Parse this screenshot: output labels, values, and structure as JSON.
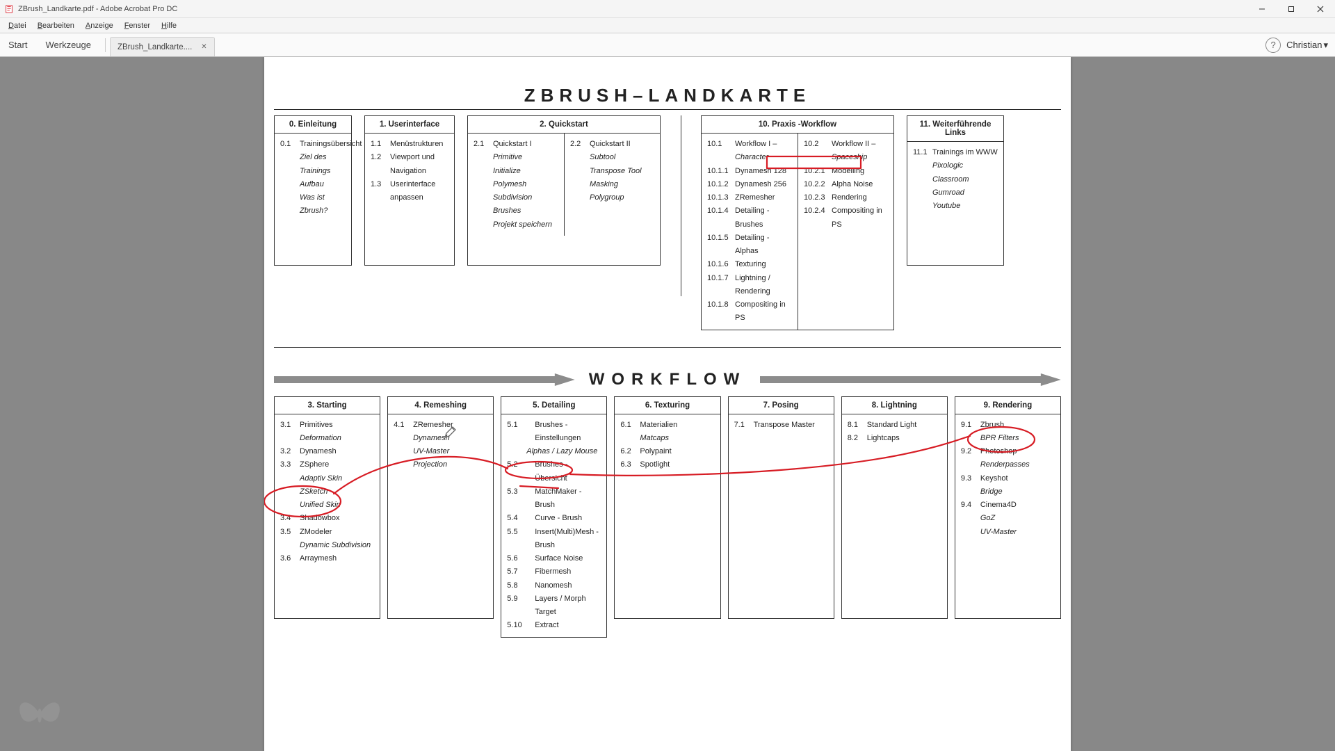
{
  "window": {
    "title": "ZBrush_Landkarte.pdf - Adobe Acrobat Pro DC"
  },
  "menu": {
    "items": [
      {
        "hot": "D",
        "rest": "atei"
      },
      {
        "hot": "B",
        "rest": "earbeiten"
      },
      {
        "hot": "A",
        "rest": "nzeige"
      },
      {
        "hot": "F",
        "rest": "enster"
      },
      {
        "hot": "H",
        "rest": "ilfe"
      }
    ]
  },
  "toolbar": {
    "start": "Start",
    "tools": "Werkzeuge",
    "tab_label": "ZBrush_Landkarte....",
    "user": "Christian"
  },
  "doc": {
    "title": "ZBRUSH–LANDKARTE",
    "workflow_heading": "WORKFLOW",
    "boxes_top": {
      "c0": {
        "header": "0. Einleitung",
        "items": [
          {
            "num": "0.1",
            "text": "Trainingsübersicht"
          },
          {
            "sub": true,
            "ital": true,
            "text": "Ziel des Trainings"
          },
          {
            "sub": true,
            "ital": true,
            "text": "Aufbau"
          },
          {
            "sub": true,
            "ital": true,
            "text": "Was ist Zbrush?"
          }
        ]
      },
      "c1": {
        "header": "1. Userinterface",
        "items": [
          {
            "num": "1.1",
            "text": "Menüstrukturen"
          },
          {
            "num": "1.2",
            "text": "Viewport und Navigation"
          },
          {
            "num": "1.3",
            "text": "Userinterface anpassen"
          }
        ]
      },
      "c2": {
        "header": "2. Quickstart",
        "left": [
          {
            "num": "2.1",
            "text": "Quickstart I"
          },
          {
            "sub": true,
            "ital": true,
            "text": "Primitive"
          },
          {
            "sub": true,
            "ital": true,
            "text": "Initialize"
          },
          {
            "sub": true,
            "ital": true,
            "text": "Polymesh"
          },
          {
            "sub": true,
            "ital": true,
            "text": "Subdivision"
          },
          {
            "sub": true,
            "ital": true,
            "text": "Brushes"
          },
          {
            "sub": true,
            "ital": true,
            "text": "Projekt speichern"
          }
        ],
        "right": [
          {
            "num": "2.2",
            "text": "Quickstart II"
          },
          {
            "sub": true,
            "ital": true,
            "text": "Subtool"
          },
          {
            "sub": true,
            "ital": true,
            "text": "Transpose Tool"
          },
          {
            "sub": true,
            "ital": true,
            "text": "Masking"
          },
          {
            "sub": true,
            "ital": true,
            "text": "Polygroup"
          }
        ]
      },
      "c10": {
        "header": "10. Praxis -Workflow",
        "left": [
          {
            "num": "10.1",
            "text": "Workflow I – Character",
            "partItal": "Character"
          },
          {
            "num": "10.1.1",
            "text": "Dynamesh 128"
          },
          {
            "num": "10.1.2",
            "text": "Dynamesh 256"
          },
          {
            "num": "10.1.3",
            "text": "ZRemesher"
          },
          {
            "num": "10.1.4",
            "text": "Detailing - Brushes"
          },
          {
            "num": "10.1.5",
            "text": "Detailing - Alphas"
          },
          {
            "num": "10.1.6",
            "text": "Texturing"
          },
          {
            "num": "10.1.7",
            "text": "Lightning / Rendering"
          },
          {
            "num": "10.1.8",
            "text": "Compositing in PS"
          }
        ],
        "right": [
          {
            "num": "10.2",
            "text": "Workflow II – Spaceship",
            "partItal": "Spaceship"
          },
          {
            "num": "10.2.1",
            "text": "Modelling"
          },
          {
            "num": "10.2.2",
            "text": "Alpha Noise"
          },
          {
            "num": "10.2.3",
            "text": "Rendering"
          },
          {
            "num": "10.2.4",
            "text": "Compositing in PS"
          }
        ]
      },
      "c11": {
        "header": "11. Weiterführende Links",
        "items": [
          {
            "num": "11.1",
            "text": "Trainings im WWW"
          },
          {
            "sub": true,
            "ital": true,
            "text": "Pixologic Classroom"
          },
          {
            "sub": true,
            "ital": true,
            "text": "Gumroad"
          },
          {
            "sub": true,
            "ital": true,
            "text": "Youtube"
          }
        ]
      }
    },
    "boxes_bottom": {
      "c3": {
        "header": "3. Starting",
        "items": [
          {
            "num": "3.1",
            "text": "Primitives"
          },
          {
            "sub": true,
            "ital": true,
            "text": "Deformation"
          },
          {
            "num": "3.2",
            "text": "Dynamesh"
          },
          {
            "num": "3.3",
            "text": "ZSphere"
          },
          {
            "sub": true,
            "ital": true,
            "text": "Adaptiv Skin"
          },
          {
            "sub": true,
            "ital": true,
            "text": "ZSketch"
          },
          {
            "sub": true,
            "ital": true,
            "text": "Unified Skin"
          },
          {
            "num": "3.4",
            "text": "Shadowbox"
          },
          {
            "num": "3.5",
            "text": "ZModeler"
          },
          {
            "sub": true,
            "ital": true,
            "text": "Dynamic Subdivision"
          },
          {
            "num": "3.6",
            "text": "Arraymesh"
          }
        ]
      },
      "c4": {
        "header": "4. Remeshing",
        "items": [
          {
            "num": "4.1",
            "text": "ZRemesher"
          },
          {
            "sub": true,
            "ital": true,
            "text": "Dynamesh"
          },
          {
            "sub": true,
            "ital": true,
            "text": "UV-Master"
          },
          {
            "sub": true,
            "ital": true,
            "text": "Projection"
          }
        ]
      },
      "c5": {
        "header": "5. Detailing",
        "items": [
          {
            "num": "5.1",
            "text": "Brushes - Einstellungen"
          },
          {
            "sub": true,
            "ital": true,
            "text": "Alphas / Lazy Mouse"
          },
          {
            "num": "5.2",
            "text": "Brushes - Übersicht"
          },
          {
            "num": "5.3",
            "text": "MatchMaker - Brush"
          },
          {
            "num": "5.4",
            "text": "Curve - Brush"
          },
          {
            "num": "5.5",
            "text": "Insert(Multi)Mesh - Brush"
          },
          {
            "num": "5.6",
            "text": "Surface Noise"
          },
          {
            "num": "5.7",
            "text": "Fibermesh"
          },
          {
            "num": "5.8",
            "text": "Nanomesh"
          },
          {
            "num": "5.9",
            "text": "Layers / Morph Target"
          },
          {
            "num": "5.10",
            "text": "Extract"
          }
        ]
      },
      "c6": {
        "header": "6. Texturing",
        "items": [
          {
            "num": "6.1",
            "text": "Materialien"
          },
          {
            "sub": true,
            "ital": true,
            "text": "Matcaps"
          },
          {
            "num": "6.2",
            "text": "Polypaint"
          },
          {
            "num": "6.3",
            "text": "Spotlight"
          }
        ]
      },
      "c7": {
        "header": "7. Posing",
        "items": [
          {
            "num": "7.1",
            "text": "Transpose Master"
          }
        ]
      },
      "c8": {
        "header": "8. Lightning",
        "items": [
          {
            "num": "8.1",
            "text": "Standard Light"
          },
          {
            "num": "8.2",
            "text": "Lightcaps"
          }
        ]
      },
      "c9": {
        "header": "9. Rendering",
        "items": [
          {
            "num": "9.1",
            "text": "Zbrush"
          },
          {
            "sub": true,
            "ital": true,
            "text": "BPR Filters"
          },
          {
            "num": "9.2",
            "text": "Photoshop"
          },
          {
            "sub": true,
            "ital": true,
            "text": "Renderpasses"
          },
          {
            "num": "9.3",
            "text": "Keyshot"
          },
          {
            "sub": true,
            "ital": true,
            "text": "Bridge"
          },
          {
            "num": "9.4",
            "text": "Cinema4D"
          },
          {
            "sub": true,
            "ital": true,
            "text": "GoZ"
          },
          {
            "sub": true,
            "ital": true,
            "text": "UV-Master"
          }
        ]
      }
    }
  },
  "colors": {
    "annotation_red": "#d71c24",
    "arrow_grey": "#8c8c8c"
  }
}
